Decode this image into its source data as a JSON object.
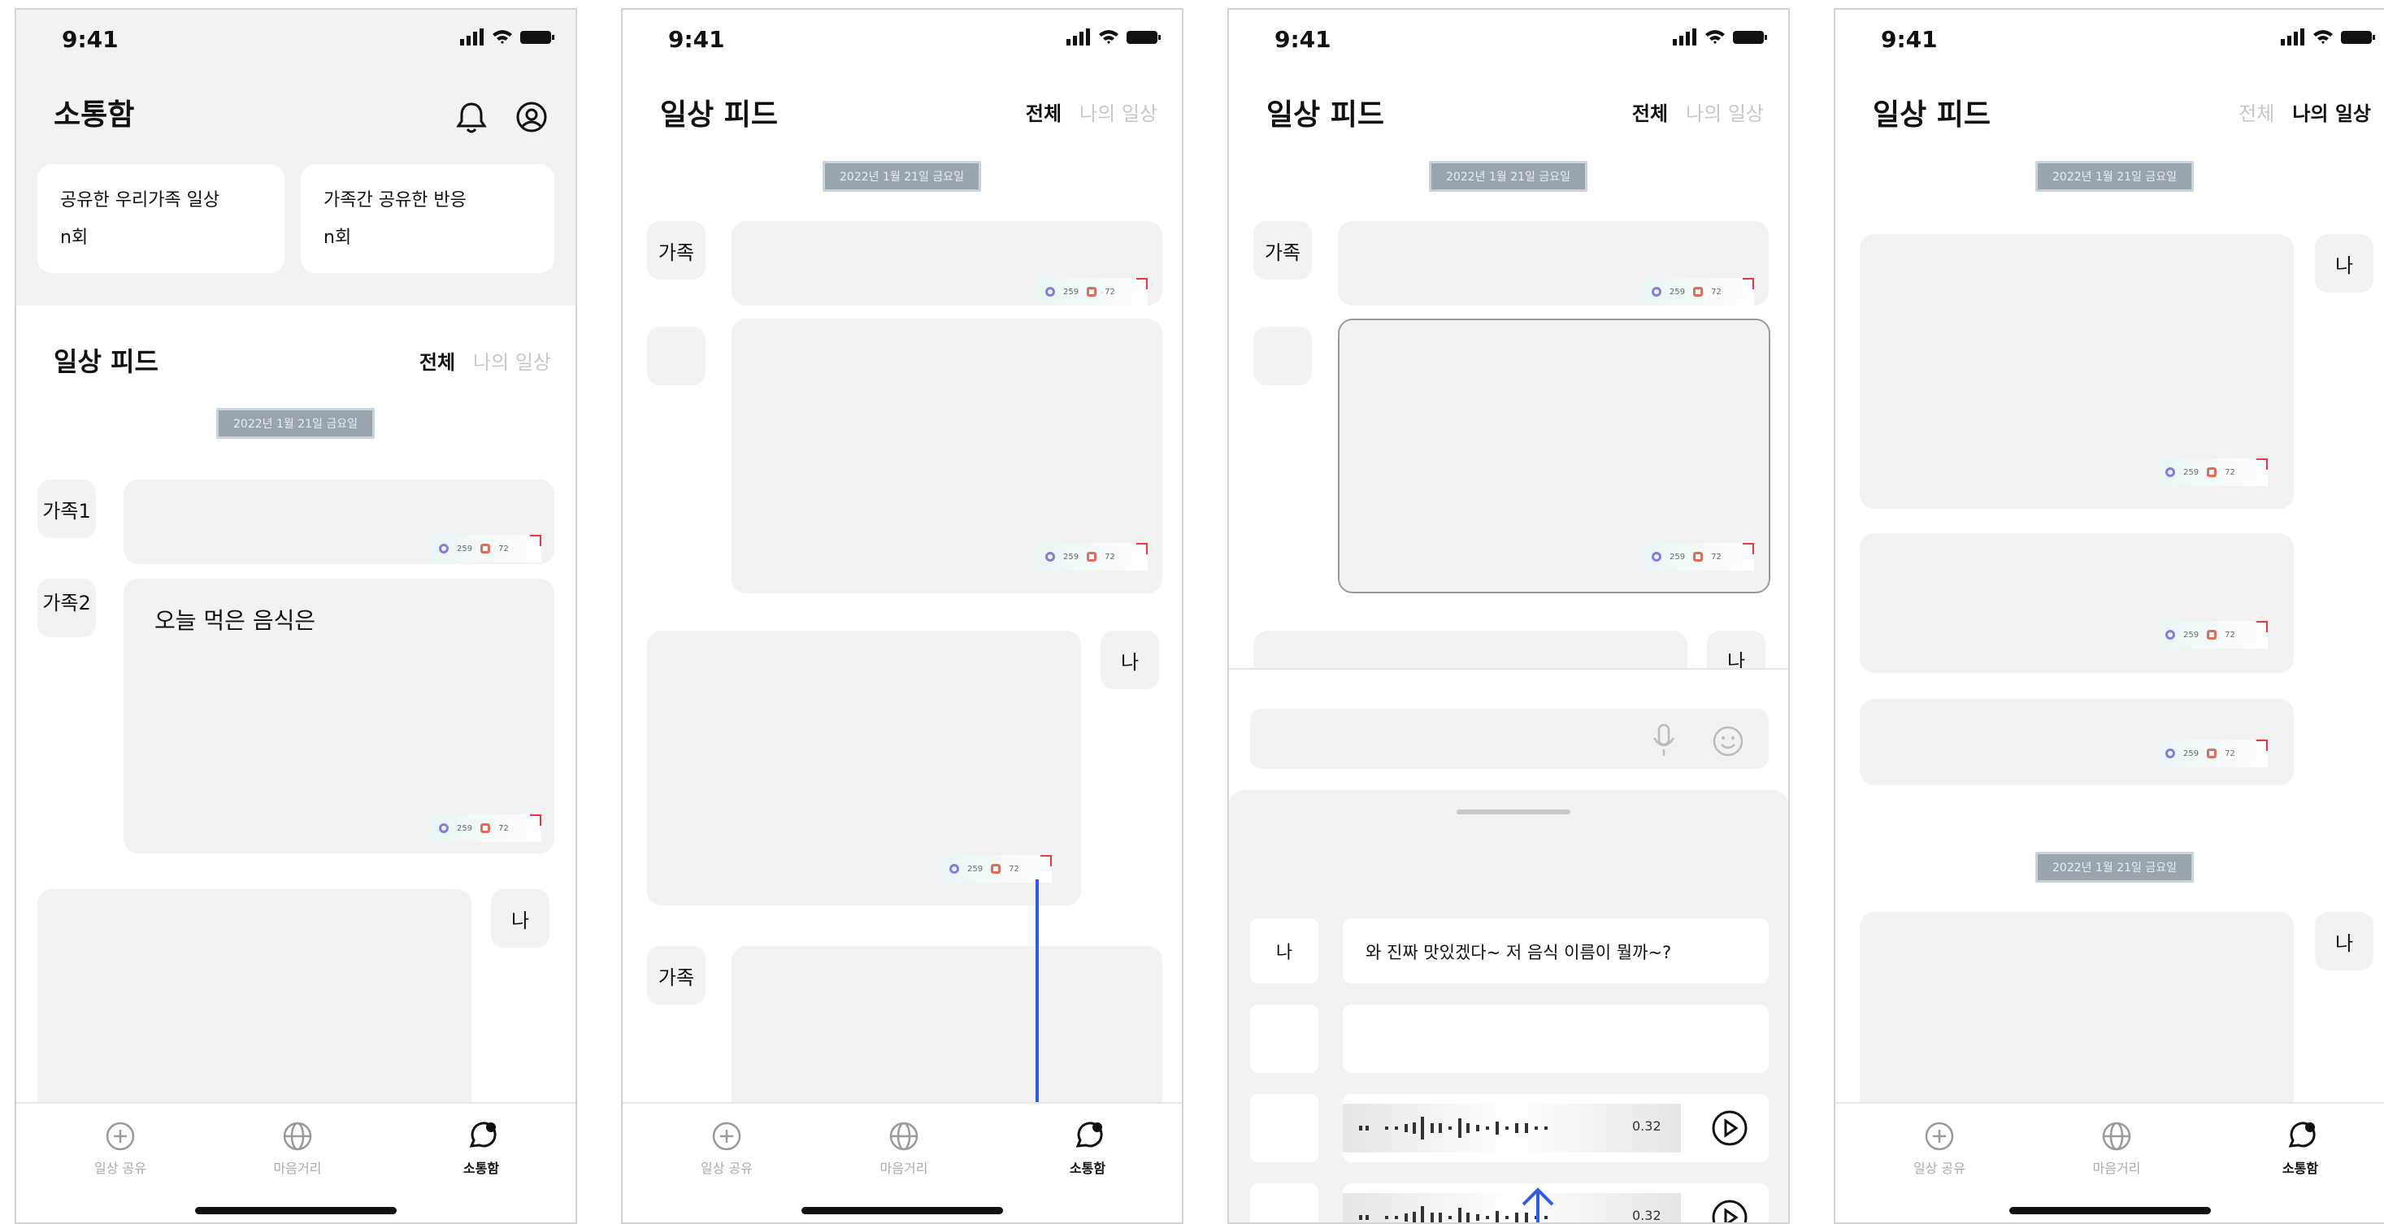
{
  "status": {
    "time": "9:41"
  },
  "screen1": {
    "title": "소통함",
    "stat_cards": [
      {
        "label": "공유한 우리가족 일상",
        "value": "n회"
      },
      {
        "label": "가족간 공유한 반응",
        "value": "n회"
      }
    ],
    "feed_title": "일상 피드",
    "tab_all": "전체",
    "tab_mine": "나의 일상",
    "date": "2022년 1월 21일 금요일",
    "avatars": [
      "가족1",
      "가족2",
      "나"
    ],
    "post_text": "오늘 먹은 음식은",
    "reaction": {
      "like": "259",
      "comment": "72"
    }
  },
  "screen2": {
    "title": "일상 피드",
    "tab_all": "전체",
    "tab_mine": "나의 일상",
    "date": "2022년 1월 21일 금요일",
    "avatars": [
      "가족",
      "나",
      "가족"
    ],
    "reaction": {
      "like": "259",
      "comment": "72"
    }
  },
  "screen3": {
    "title": "일상 피드",
    "tab_all": "전체",
    "tab_mine": "나의 일상",
    "date": "2022년 1월 21일 금요일",
    "avatars": [
      "가족",
      "나"
    ],
    "reaction": {
      "like": "259",
      "comment": "72"
    },
    "comment_me": "나",
    "comment_text": "와 진짜 맛있겠다~ 저 음식 이름이 뭘까~?",
    "voice_duration": "0.32"
  },
  "screen4": {
    "title": "일상 피드",
    "tab_all": "전체",
    "tab_mine": "나의 일상",
    "date": "2022년 1월 21일 금요일",
    "avatars": [
      "나",
      "나"
    ],
    "reaction": {
      "like": "259",
      "comment": "72"
    }
  },
  "nav": {
    "share": "일상 공유",
    "distance": "마음거리",
    "inbox": "소통함"
  },
  "colors": {
    "accent_blue": "#2f5be8",
    "card_bg": "#f2f2f2"
  }
}
